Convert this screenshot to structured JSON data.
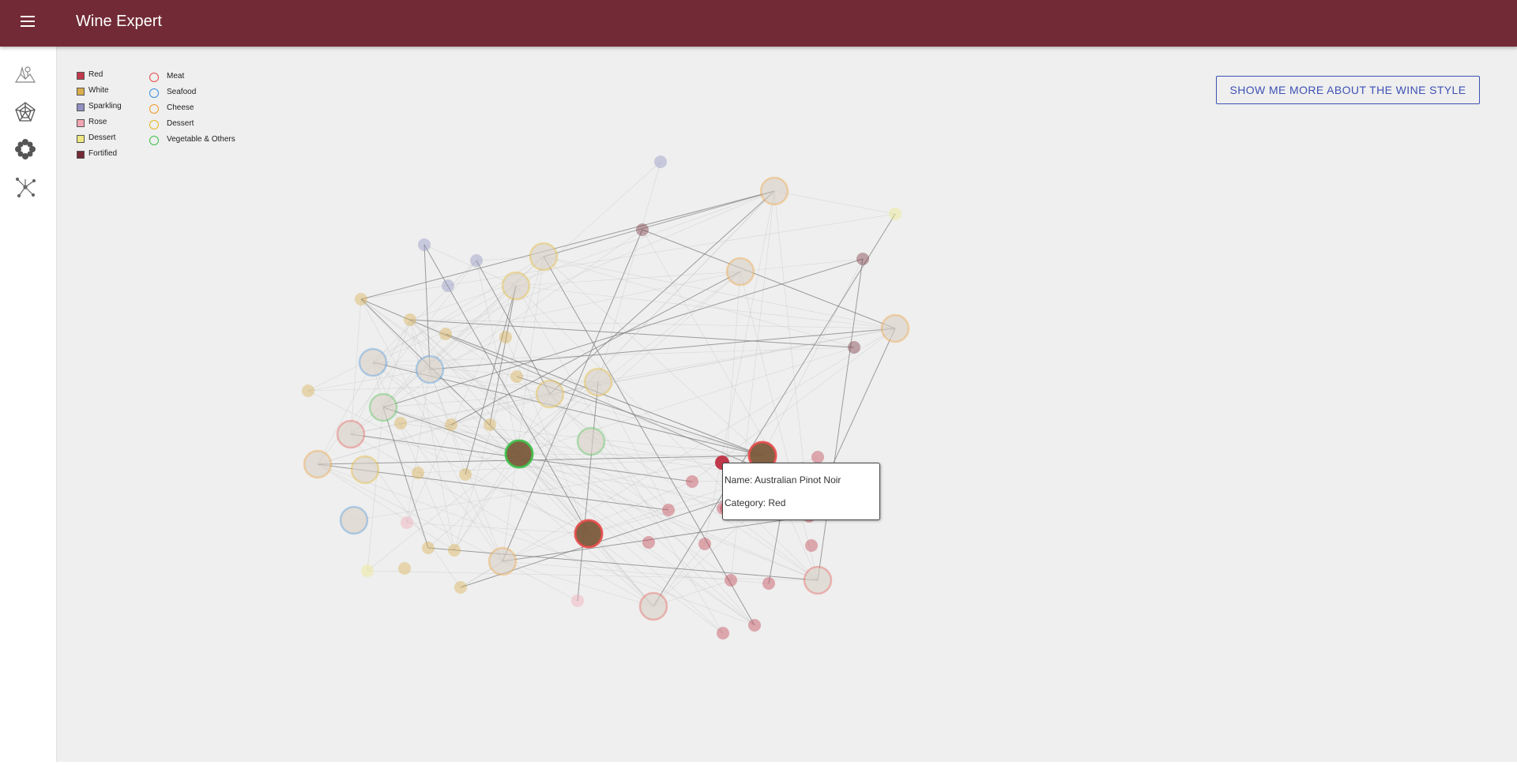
{
  "app": {
    "title": "Wine Expert",
    "menu_icon": "menu-icon"
  },
  "sidebar": {
    "items": [
      {
        "name": "map-icon"
      },
      {
        "name": "radar-chart-icon"
      },
      {
        "name": "flower-chart-icon"
      },
      {
        "name": "network-graph-icon"
      }
    ]
  },
  "legend": {
    "wine_types": [
      {
        "label": "Red",
        "color": "#c0394b"
      },
      {
        "label": "White",
        "color": "#d9ad4c"
      },
      {
        "label": "Sparkling",
        "color": "#8f8fc0"
      },
      {
        "label": "Rose",
        "color": "#f2a6b4"
      },
      {
        "label": "Dessert",
        "color": "#eee882"
      },
      {
        "label": "Fortified",
        "color": "#722b36"
      }
    ],
    "food_types": [
      {
        "label": "Meat",
        "color": "#e74c4c"
      },
      {
        "label": "Seafood",
        "color": "#3b8fe0"
      },
      {
        "label": "Cheese",
        "color": "#f39a2c"
      },
      {
        "label": "Dessert",
        "color": "#e8b820"
      },
      {
        "label": "Vegetable & Others",
        "color": "#3fc04a"
      }
    ]
  },
  "action_button": {
    "label": "SHOW ME MORE ABOUT THE WINE STYLE"
  },
  "tooltip": {
    "name_line": "Name: Australian Pinot Noir",
    "category_line": "Category: Red"
  }
}
